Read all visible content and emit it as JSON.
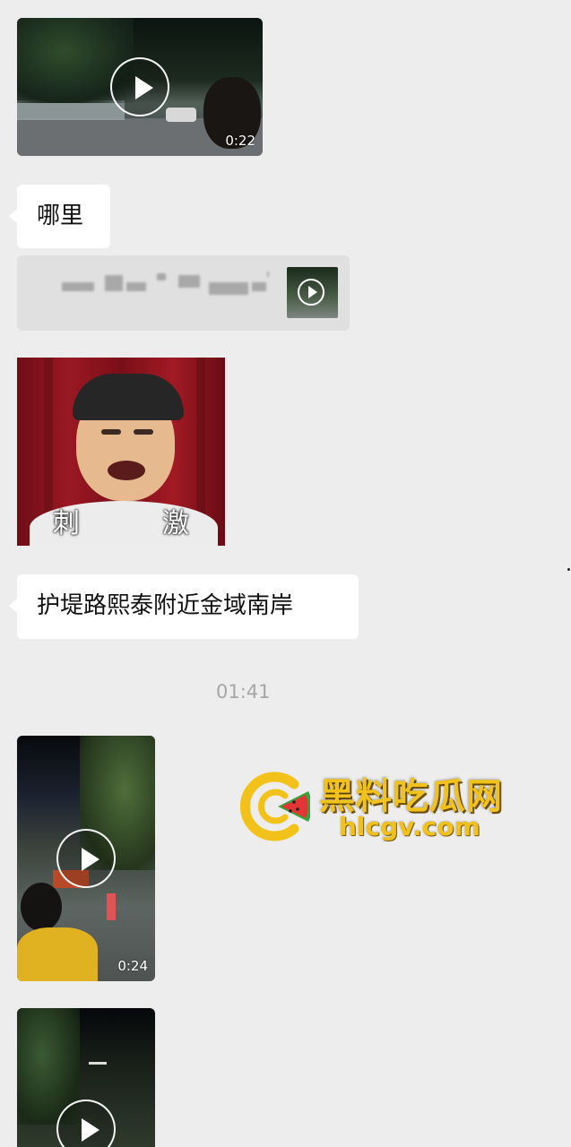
{
  "messages": {
    "video1": {
      "duration": "0:22"
    },
    "text1": {
      "text": "哪里"
    },
    "quote": {},
    "sticker": {
      "caption_left": "刺",
      "caption_right": "激"
    },
    "text2": {
      "text": "护堤路熙泰附近金域南岸"
    },
    "timestamp": "01:41",
    "video2": {
      "duration": "0:24"
    },
    "video3": {}
  },
  "watermark": {
    "title": "黑料吃瓜网",
    "url": "hlcgv.com"
  },
  "colors": {
    "background": "#ededed",
    "bubble": "#ffffff",
    "watermark": "#f2c21a"
  }
}
